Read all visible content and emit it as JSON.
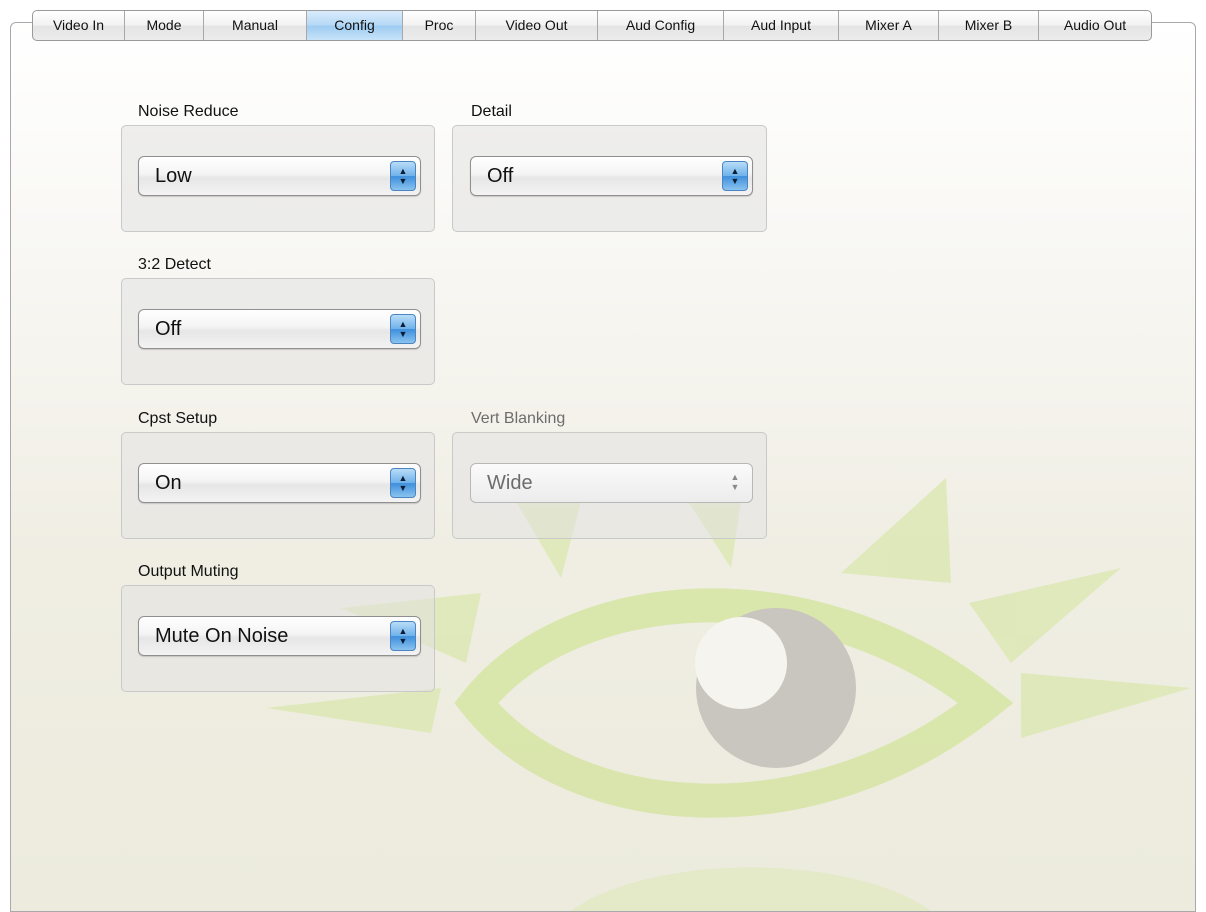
{
  "tabs": [
    {
      "label": "Video In"
    },
    {
      "label": "Mode"
    },
    {
      "label": "Manual"
    },
    {
      "label": "Config"
    },
    {
      "label": "Proc"
    },
    {
      "label": "Video Out"
    },
    {
      "label": "Aud Config"
    },
    {
      "label": "Aud Input"
    },
    {
      "label": "Mixer A"
    },
    {
      "label": "Mixer B"
    },
    {
      "label": "Audio Out"
    }
  ],
  "active_tab": "Config",
  "controls": {
    "noise_reduce": {
      "label": "Noise Reduce",
      "value": "Low",
      "enabled": true
    },
    "detail": {
      "label": "Detail",
      "value": "Off",
      "enabled": true
    },
    "detect_32": {
      "label": "3:2 Detect",
      "value": "Off",
      "enabled": true
    },
    "cpst_setup": {
      "label": "Cpst Setup",
      "value": "On",
      "enabled": true
    },
    "vert_blanking": {
      "label": "Vert Blanking",
      "value": "Wide",
      "enabled": false
    },
    "output_muting": {
      "label": "Output Muting",
      "value": "Mute On Noise",
      "enabled": true
    }
  },
  "icons": {
    "popup_arrows": "updown-arrows-icon",
    "watermark": "eye-logo-icon"
  },
  "colors": {
    "active_tab": "#b5d8f6",
    "popup_arrow_accent": "#3e8fdc",
    "watermark_green": "#d9e6ab",
    "watermark_gray": "#c7c5bd"
  }
}
